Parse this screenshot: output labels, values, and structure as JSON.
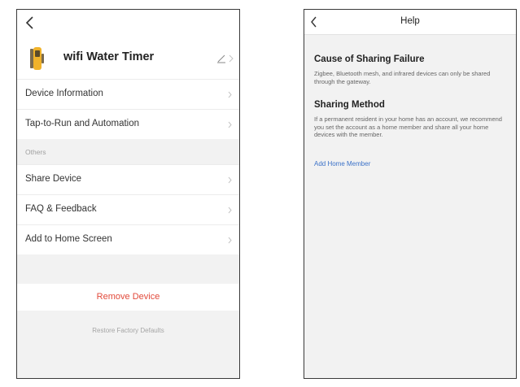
{
  "left_screen": {
    "device_name": "wifi Water Timer",
    "menu": [
      {
        "label": "Device Information"
      },
      {
        "label": "Tap-to-Run and Automation"
      }
    ],
    "section_others": "Others",
    "others_menu": [
      {
        "label": "Share Device"
      },
      {
        "label": "FAQ & Feedback"
      },
      {
        "label": "Add to Home Screen"
      }
    ],
    "remove_label": "Remove Device",
    "restore_label": "Restore Factory Defaults",
    "colors": {
      "remove": "#e24a3b"
    }
  },
  "right_screen": {
    "title": "Help",
    "section1_title": "Cause of Sharing Failure",
    "section1_text": "Zigbee, Bluetooth mesh, and infrared devices can only be shared through the gateway.",
    "section2_title": "Sharing Method",
    "section2_text": "If a permanent resident in your home has an account, we recommend you set the account as a home member and share all your home devices with the member.",
    "link_label": "Add Home Member",
    "colors": {
      "link": "#3c72c8"
    }
  }
}
